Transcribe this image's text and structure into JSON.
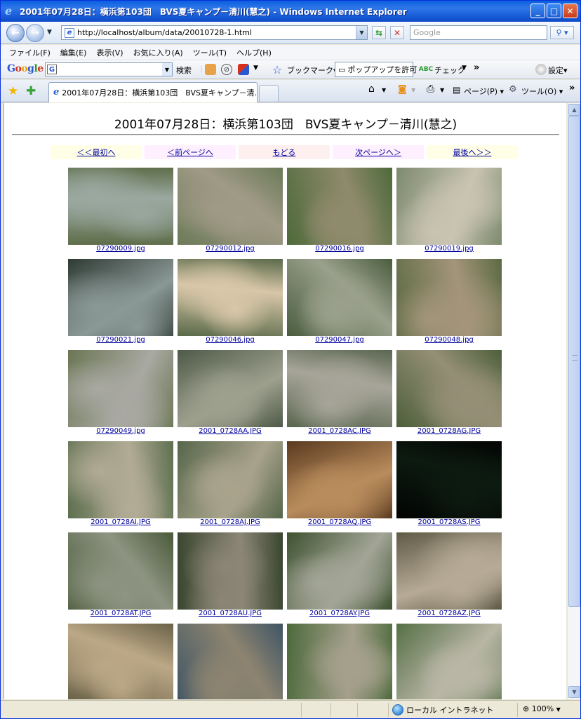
{
  "window": {
    "title": "2001年07月28日：横浜第103団　BVS夏キャンプ－清川(慧之) - Windows Internet Explorer"
  },
  "address": {
    "url": "http://localhost/album/data/20010728-1.html",
    "search_placeholder": "Google"
  },
  "menu": [
    "ファイル(F)",
    "編集(E)",
    "表示(V)",
    "お気に入り(A)",
    "ツール(T)",
    "ヘルプ(H)"
  ],
  "google_toolbar": {
    "logo": [
      "G",
      "o",
      "o",
      "g",
      "l",
      "e"
    ],
    "search_label": "検索",
    "bookmark_label": "ブックマーク▾",
    "popup_label": "ポップアップを許可",
    "check_label": "チェック",
    "more": "»",
    "settings_label": "設定▾"
  },
  "tabs": {
    "active_label": "2001年07月28日：横浜第103団　BVS夏キャンプ－清...",
    "home_label": "",
    "page_label": "ページ(P) ▾",
    "tools_label": "ツール(O) ▾",
    "more": "»"
  },
  "page": {
    "title": "2001年07月28日：横浜第103団　BVS夏キャンプ－清川(慧之)",
    "nav": [
      {
        "label": "＜＜最初へ",
        "bg": "#ffffe8"
      },
      {
        "label": "＜前ページへ",
        "bg": "#fff0ff"
      },
      {
        "label": "もどる",
        "bg": "#fff0f0"
      },
      {
        "label": "次ページへ＞",
        "bg": "#fff0ff"
      },
      {
        "label": "最後へ＞＞",
        "bg": "#ffffe8"
      }
    ],
    "photos": [
      {
        "caption": "07290009.jpg",
        "c1": "#5f6e4a",
        "c2": "#9aa8a0"
      },
      {
        "caption": "07290012.jpg",
        "c1": "#6c7a58",
        "c2": "#a09a86"
      },
      {
        "caption": "07290016.jpg",
        "c1": "#4e6a3a",
        "c2": "#8f8a6c"
      },
      {
        "caption": "07290019.jpg",
        "c1": "#7d8a6e",
        "c2": "#c9c4b2"
      },
      {
        "caption": "07290021.jpg",
        "c1": "#2f3a33",
        "c2": "#8a9896"
      },
      {
        "caption": "07290046.jpg",
        "c1": "#5a6a4a",
        "c2": "#d8c7a8"
      },
      {
        "caption": "07290047.jpg",
        "c1": "#4a5d3e",
        "c2": "#9aa08c"
      },
      {
        "caption": "07290048.jpg",
        "c1": "#5c6a44",
        "c2": "#a4957a"
      },
      {
        "caption": "07290049.jpg",
        "c1": "#6b7654",
        "c2": "#a9a9a2"
      },
      {
        "caption": "2001_0728AA.JPG",
        "c1": "#4f5a48",
        "c2": "#9ea08e"
      },
      {
        "caption": "2001_0728AC.JPG",
        "c1": "#5a6650",
        "c2": "#a7a599"
      },
      {
        "caption": "2001_0728AG.JPG",
        "c1": "#4d5f3b",
        "c2": "#958f76"
      },
      {
        "caption": "2001_0728AI.JPG",
        "c1": "#5e7050",
        "c2": "#b2ab95"
      },
      {
        "caption": "2001_0728AJ.JPG",
        "c1": "#56664a",
        "c2": "#a9a38c"
      },
      {
        "caption": "2001_0728AQ.JPG",
        "c1": "#5a3a20",
        "c2": "#b98c5c"
      },
      {
        "caption": "2001_0728AS.JPG",
        "c1": "#030403",
        "c2": "#0c1a10"
      },
      {
        "caption": "2001_0728AT.JPG",
        "c1": "#4a5a3a",
        "c2": "#8e9482"
      },
      {
        "caption": "2001_0728AU.JPG",
        "c1": "#3a4630",
        "c2": "#8c8676"
      },
      {
        "caption": "2001_0728AY.JPG",
        "c1": "#3e5230",
        "c2": "#a3a597"
      },
      {
        "caption": "2001_0728AZ.JPG",
        "c1": "#5f5a46",
        "c2": "#b7ab97"
      },
      {
        "caption": "",
        "c1": "#6a6248",
        "c2": "#bca886"
      },
      {
        "caption": "",
        "c1": "#3f5565",
        "c2": "#8d8470"
      },
      {
        "caption": "",
        "c1": "#4d6a3c",
        "c2": "#a5a08c"
      },
      {
        "caption": "",
        "c1": "#557046",
        "c2": "#b9b6a6"
      }
    ]
  },
  "status": {
    "zone_label": "ローカル イントラネット",
    "zoom_label": "100%"
  }
}
